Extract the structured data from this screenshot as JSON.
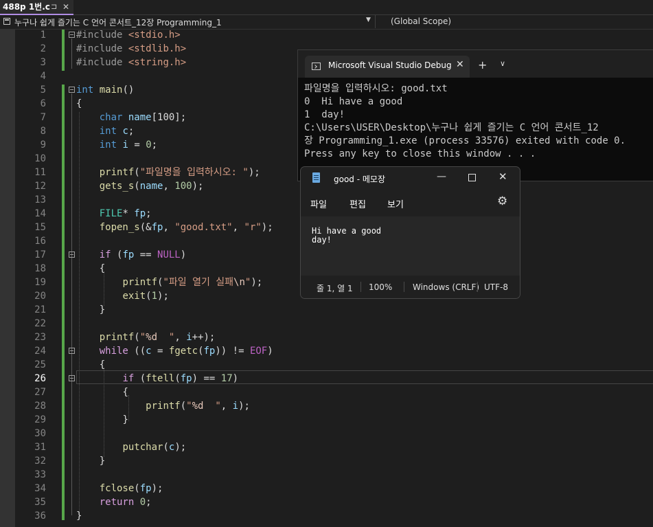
{
  "tab": {
    "title": "488p 1번.c",
    "pin_glyph": "⊐",
    "close_glyph": "✕"
  },
  "navbar": {
    "project": "누구나 쉽게 즐기는 C 언어 콘서트_12장 Programming_1",
    "scope": "(Global Scope)"
  },
  "editor": {
    "current_line": 26,
    "line_numbers": [
      "1",
      "2",
      "3",
      "4",
      "5",
      "6",
      "7",
      "8",
      "9",
      "10",
      "11",
      "12",
      "13",
      "14",
      "15",
      "16",
      "17",
      "18",
      "19",
      "20",
      "21",
      "22",
      "23",
      "24",
      "25",
      "26",
      "27",
      "28",
      "29",
      "30",
      "31",
      "32",
      "33",
      "34",
      "35",
      "36"
    ],
    "code": {
      "inc1": {
        "kw": "#include",
        "hdr": "<stdio.h>"
      },
      "inc2": {
        "kw": "#include",
        "hdr": "<stdlib.h>"
      },
      "inc3": {
        "kw": "#include",
        "hdr": "<string.h>"
      },
      "main_int": "int",
      "main_name": "main",
      "main_parens": "()",
      "brace_open": "{",
      "brace_close": "}",
      "l7": {
        "type": "char",
        "var": "name",
        "rest": "[100];"
      },
      "l8": {
        "type": "int",
        "var": "c",
        "rest": ";"
      },
      "l9": {
        "type": "int",
        "var": "i",
        "eq": " = ",
        "num": "0",
        "semi": ";"
      },
      "l11": {
        "fn": "printf",
        "open": "(",
        "str": "\"파일명을 입력하시오: \"",
        "close": ");"
      },
      "l12": {
        "fn": "gets_s",
        "open": "(",
        "var": "name",
        "comma": ", ",
        "num": "100",
        "close": ");"
      },
      "l14": {
        "type": "FILE",
        "star": "* ",
        "var": "fp",
        "semi": ";"
      },
      "l15": {
        "fn": "fopen_s",
        "open": "(&",
        "var": "fp",
        "comma": ", ",
        "str1": "\"good.txt\"",
        "comma2": ", ",
        "str2": "\"r\"",
        "close": ");"
      },
      "l17": {
        "kw": "if",
        "open": " (",
        "var": "fp",
        "op": " == ",
        "mac": "NULL",
        "close": ")"
      },
      "l19": {
        "fn": "printf",
        "open": "(",
        "str": "\"파일 열기 실패",
        "esc": "\\n",
        "str_end": "\"",
        "close": ");"
      },
      "l20": {
        "fn": "exit",
        "open": "(",
        "num": "1",
        "close": ");"
      },
      "l23": {
        "fn": "printf",
        "open": "(",
        "str_q": "\"",
        "fmt": "%d",
        "str_rest": "  \"",
        "comma": ", ",
        "var": "i",
        "rest": "++);"
      },
      "l24": {
        "kw": "while",
        "open": " ((",
        "var": "c",
        "eq": " = ",
        "fn": "fgetc",
        "open2": "(",
        "var2": "fp",
        "close": ")) != ",
        "mac": "EOF",
        "end": ")"
      },
      "l26": {
        "kw": "if",
        "open": " (",
        "fn": "ftell",
        "open2": "(",
        "var": "fp",
        "close": ") == ",
        "num": "17",
        "end": ")"
      },
      "l28": {
        "fn": "printf",
        "open": "(",
        "str_q": "\"",
        "fmt": "%d",
        "str_rest": "  \"",
        "comma": ", ",
        "var": "i",
        "close": ");"
      },
      "l31": {
        "fn": "putchar",
        "open": "(",
        "var": "c",
        "close": ");"
      },
      "l34": {
        "fn": "fclose",
        "open": "(",
        "var": "fp",
        "close": ");"
      },
      "l35": {
        "kw": "return",
        "sp": " ",
        "num": "0",
        "semi": ";"
      }
    }
  },
  "console": {
    "tab_title": "Microsoft Visual Studio Debug",
    "close_glyph": "✕",
    "plus_glyph": "+",
    "chevron_glyph": "∨",
    "lines": [
      "파일명을 입력하시오: good.txt",
      "0  Hi have a good",
      "1  day!",
      "C:\\Users\\USER\\Desktop\\누구나 쉽게 즐기는 C 언어 콘서트_12",
      "장 Programming_1.exe (process 33576) exited with code 0.",
      "Press any key to close this window . . ."
    ]
  },
  "notepad": {
    "title": "good - 메모장",
    "min_glyph": "—",
    "close_glyph": "✕",
    "gear_glyph": "⚙",
    "menu": {
      "file": "파일",
      "edit": "편집",
      "view": "보기"
    },
    "content": "Hi have a good\nday!",
    "status": {
      "position": "줄 1, 열 1",
      "zoom": "100%",
      "eol": "Windows (CRLF)",
      "encoding": "UTF-8"
    }
  }
}
